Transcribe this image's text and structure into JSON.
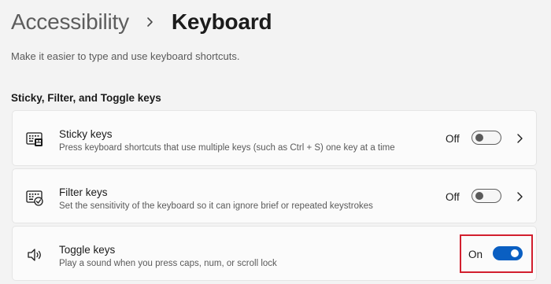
{
  "breadcrumb": {
    "parent": "Accessibility",
    "current": "Keyboard"
  },
  "subtitle": "Make it easier to type and use keyboard shortcuts.",
  "section": {
    "title": "Sticky, Filter, and Toggle keys"
  },
  "settings": [
    {
      "title": "Sticky keys",
      "description": "Press keyboard shortcuts that use multiple keys (such as Ctrl + S) one key at a time",
      "state": "Off",
      "icon": "sticky-keys-icon",
      "has_chevron": true
    },
    {
      "title": "Filter keys",
      "description": "Set the sensitivity of the keyboard so it can ignore brief or repeated keystrokes",
      "state": "Off",
      "icon": "filter-keys-icon",
      "has_chevron": true
    },
    {
      "title": "Toggle keys",
      "description": "Play a sound when you press caps, num, or scroll lock",
      "state": "On",
      "icon": "speaker-icon",
      "has_chevron": false
    }
  ],
  "colors": {
    "accent": "#0a5fc2",
    "highlight": "#d21f2e",
    "background": "#f3f3f3",
    "card": "#fbfbfb"
  }
}
